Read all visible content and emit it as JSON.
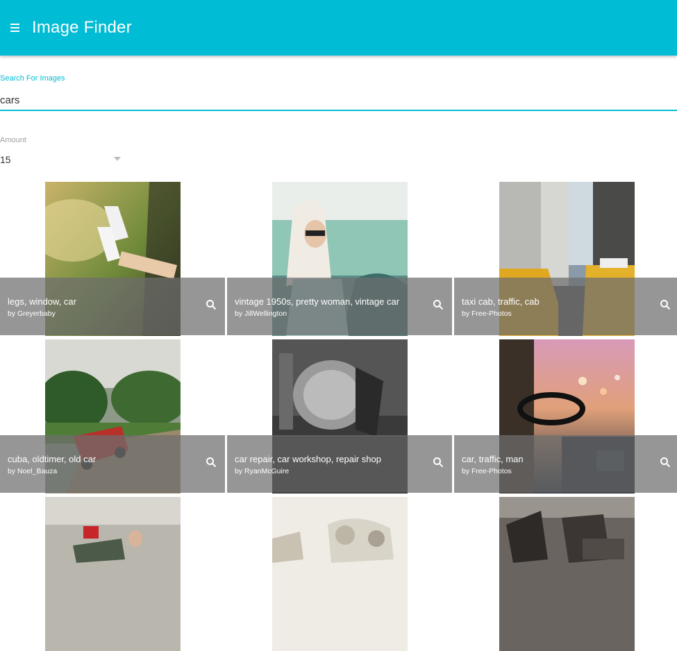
{
  "app": {
    "title": "Image Finder",
    "menu_icon": "menu-icon",
    "accent": "#00bcd4"
  },
  "search": {
    "label": "Search For Images",
    "value": "cars"
  },
  "amount": {
    "label": "Amount",
    "value": "15"
  },
  "results": [
    {
      "title": "legs, window, car",
      "author": "by Greyerbaby"
    },
    {
      "title": "vintage 1950s, pretty woman, vintage car",
      "author": "by JillWellington"
    },
    {
      "title": "taxi cab, traffic, cab",
      "author": "by Free-Photos"
    },
    {
      "title": "cuba, oldtimer, old car",
      "author": "by Noel_Bauza"
    },
    {
      "title": "car repair, car workshop, repair shop",
      "author": "by RyanMcGuire"
    },
    {
      "title": "car, traffic, man",
      "author": "by Free-Photos"
    },
    {
      "title": "",
      "author": ""
    },
    {
      "title": "",
      "author": ""
    },
    {
      "title": "",
      "author": ""
    }
  ]
}
